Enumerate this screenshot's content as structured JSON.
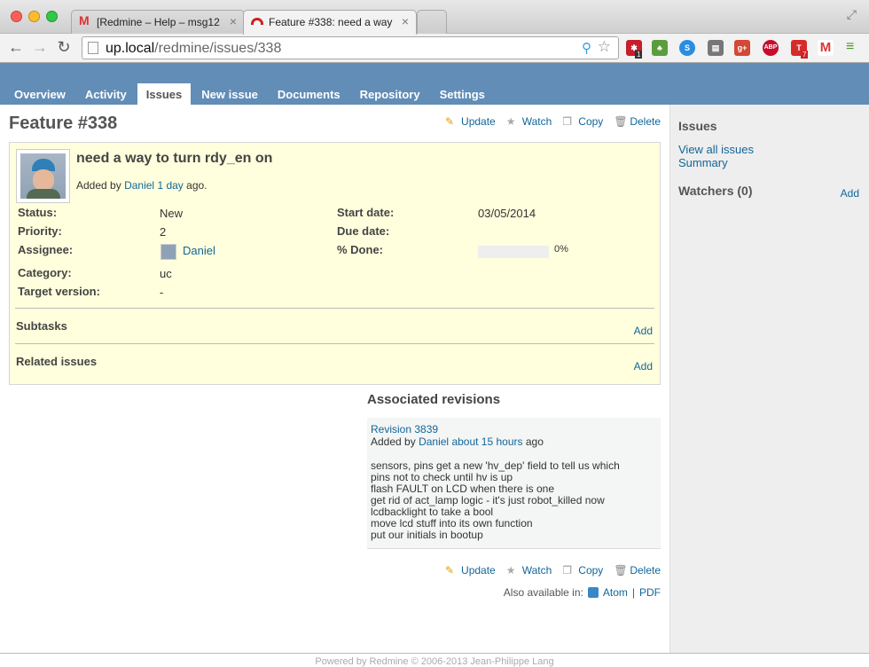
{
  "browser": {
    "tabs": [
      {
        "label": "[Redmine – Help – msg12",
        "count": "0"
      },
      {
        "label": "Feature #338: need a way"
      }
    ],
    "url_host": "up.local",
    "url_path": "/redmine/issues/338",
    "ext_badges": {
      "ext1": "1",
      "ext7": "7"
    },
    "ext_labels": {
      "abp": "ABP"
    }
  },
  "menu": {
    "items": [
      "Overview",
      "Activity",
      "Issues",
      "New issue",
      "Documents",
      "Repository",
      "Settings"
    ],
    "selected": "Issues"
  },
  "issue": {
    "title": "Feature #338",
    "subject": "need a way to turn rdy_en on",
    "added_prefix": "Added by",
    "author": "Daniel",
    "age": "1 day",
    "age_suffix": "ago.",
    "attributes": {
      "status_label": "Status:",
      "status": "New",
      "priority_label": "Priority:",
      "priority": "2",
      "assignee_label": "Assignee:",
      "assignee": "Daniel",
      "category_label": "Category:",
      "category": "uc",
      "target_label": "Target version:",
      "target": "-",
      "start_label": "Start date:",
      "start": "03/05/2014",
      "due_label": "Due date:",
      "due": "",
      "done_label": "% Done:",
      "done": "0%",
      "done_fraction": 0
    },
    "subtasks_title": "Subtasks",
    "related_title": "Related issues",
    "add_label": "Add"
  },
  "actions": {
    "update": "Update",
    "watch": "Watch",
    "copy": "Copy",
    "delete": "Delete"
  },
  "revisions": {
    "title": "Associated revisions",
    "revision": "Revision 3839",
    "added_prefix": "Added by",
    "author": "Daniel",
    "age": "about 15 hours",
    "age_suffix": "ago",
    "message": "sensors, pins get a new 'hv_dep' field to tell us which\npins not to check until hv is up\nflash FAULT on LCD when there is one\nget rid of act_lamp logic - it's just robot_killed now\nlcdbacklight to take a bool\nmove lcd stuff into its own function\nput our initials in bootup"
  },
  "formats": {
    "prefix": "Also available in:",
    "atom": "Atom",
    "sep": "|",
    "pdf": "PDF"
  },
  "sidebar": {
    "issues_title": "Issues",
    "view_all": "View all issues",
    "summary": "Summary",
    "watchers_title": "Watchers (0)",
    "watchers_add": "Add"
  },
  "footer": "Powered by Redmine © 2006-2013 Jean-Philippe Lang"
}
